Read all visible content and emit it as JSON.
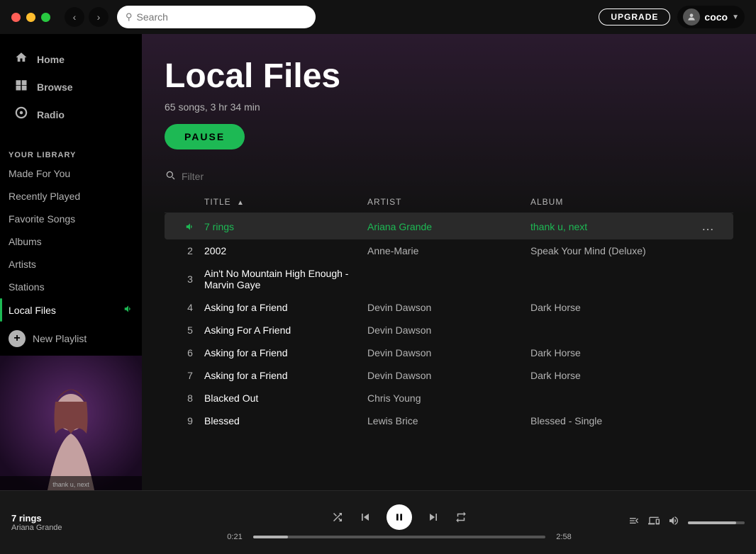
{
  "window": {
    "title": "Local Files"
  },
  "top_bar": {
    "search_placeholder": "Search",
    "upgrade_label": "UPGRADE",
    "user_name": "coco"
  },
  "sidebar": {
    "nav_items": [
      {
        "id": "home",
        "label": "Home",
        "icon": "⌂"
      },
      {
        "id": "browse",
        "label": "Browse",
        "icon": "⊞"
      },
      {
        "id": "radio",
        "label": "Radio",
        "icon": "◎"
      }
    ],
    "section_label": "YOUR LIBRARY",
    "library_items": [
      {
        "id": "made-for-you",
        "label": "Made For You"
      },
      {
        "id": "recently-played",
        "label": "Recently Played"
      },
      {
        "id": "favorite-songs",
        "label": "Favorite Songs"
      },
      {
        "id": "albums",
        "label": "Albums"
      },
      {
        "id": "artists",
        "label": "Artists"
      },
      {
        "id": "stations",
        "label": "Stations"
      }
    ],
    "local_files_label": "Local Files",
    "new_playlist_label": "New Playlist"
  },
  "content": {
    "page_title": "Local Files",
    "page_meta": "65 songs, 3 hr 34 min",
    "pause_label": "PAUSE",
    "filter_placeholder": "Filter",
    "table_headers": {
      "title": "TITLE",
      "artist": "ARTIST",
      "album": "ALBUM"
    },
    "tracks": [
      {
        "id": 1,
        "title": "7 rings",
        "artist": "Ariana Grande",
        "album": "thank u, next",
        "playing": true
      },
      {
        "id": 2,
        "title": "2002",
        "artist": "Anne-Marie",
        "album": "Speak Your Mind (Deluxe)",
        "playing": false
      },
      {
        "id": 3,
        "title": "Ain't No Mountain High Enough - Marvin Gaye",
        "artist": "",
        "album": "",
        "playing": false
      },
      {
        "id": 4,
        "title": "Asking for a Friend",
        "artist": "Devin Dawson",
        "album": "Dark Horse",
        "playing": false
      },
      {
        "id": 5,
        "title": "Asking For A Friend",
        "artist": "Devin Dawson",
        "album": "",
        "playing": false
      },
      {
        "id": 6,
        "title": "Asking for a Friend",
        "artist": "Devin Dawson",
        "album": "Dark Horse",
        "playing": false
      },
      {
        "id": 7,
        "title": "Asking for a Friend",
        "artist": "Devin Dawson",
        "album": "Dark Horse",
        "playing": false
      },
      {
        "id": 8,
        "title": "Blacked Out",
        "artist": "Chris Young",
        "album": "",
        "playing": false
      },
      {
        "id": 9,
        "title": "Blessed",
        "artist": "Lewis Brice",
        "album": "Blessed - Single",
        "playing": false
      }
    ]
  },
  "player": {
    "track_name": "7 rings",
    "track_artist": "Ariana Grande",
    "time_current": "0:21",
    "time_total": "2:58",
    "progress_percent": 12,
    "volume_percent": 85
  },
  "colors": {
    "green": "#1db954",
    "background": "#121212",
    "sidebar_bg": "#000000",
    "surface": "#181818",
    "text_primary": "#ffffff",
    "text_secondary": "#b3b3b3"
  }
}
